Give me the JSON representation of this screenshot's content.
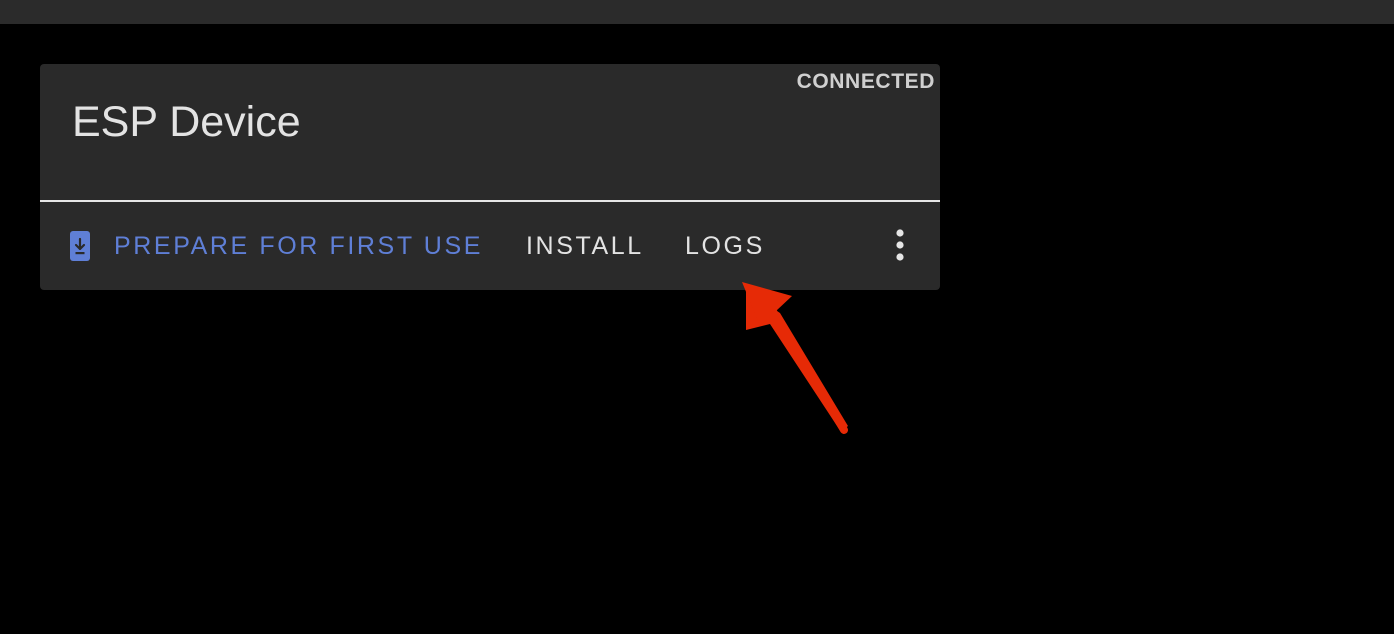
{
  "device_card": {
    "status": "CONNECTED",
    "title": "ESP Device",
    "actions": {
      "prepare_label": "PREPARE FOR FIRST USE",
      "install_label": "INSTALL",
      "logs_label": "LOGS"
    },
    "icons": {
      "prepare": "phone-download-icon",
      "menu": "more-vertical-icon"
    }
  },
  "colors": {
    "page_background": "#000000",
    "card_background": "#2a2a2a",
    "accent": "#5f7fd6",
    "annotation": "#e62a06"
  }
}
